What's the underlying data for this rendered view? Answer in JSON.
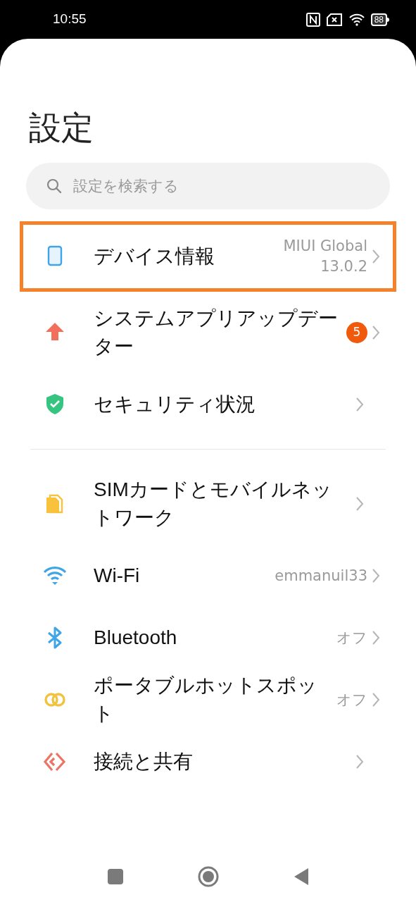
{
  "status_bar": {
    "time": "10:55",
    "battery": "88"
  },
  "title": "設定",
  "search": {
    "placeholder": "設定を検索する"
  },
  "sections": [
    {
      "items": [
        {
          "label": "デバイス情報",
          "value": "MIUI Global\n13.0.2",
          "highlighted": true
        },
        {
          "label": "システムアプリアップデーター",
          "badge": "5",
          "highlighted": false
        },
        {
          "label": "セキュリティ状況",
          "highlighted": false
        }
      ]
    },
    {
      "items": [
        {
          "label": "SIMカードとモバイルネットワーク",
          "highlighted": false
        },
        {
          "label": "Wi-Fi",
          "value": "emmanuil33",
          "highlighted": false
        },
        {
          "label": "Bluetooth",
          "value": "オフ",
          "highlighted": false
        },
        {
          "label": "ポータブルホットスポット",
          "value": "オフ",
          "highlighted": false
        },
        {
          "label": "接続と共有",
          "highlighted": false
        }
      ]
    }
  ]
}
